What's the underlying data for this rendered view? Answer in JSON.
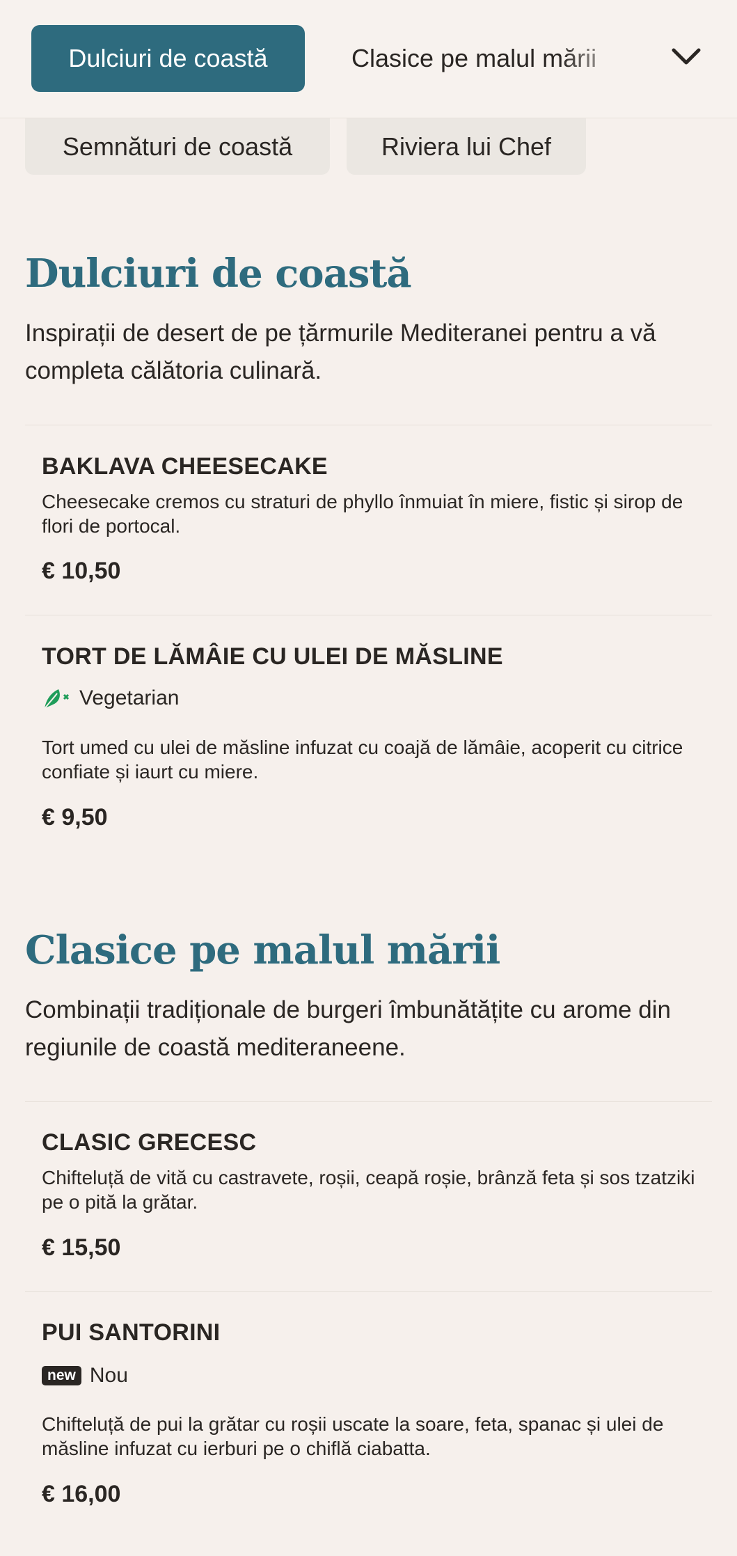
{
  "nav": {
    "active_category": "Dulciuri de coastă",
    "next_category": "Clasice pe malul mării",
    "pills": [
      "Semnături de coastă",
      "Riviera lui Chef"
    ],
    "dropdown_icon": "chevron-down-icon"
  },
  "colors": {
    "accent": "#2e6b7e",
    "background": "#f6f0ec",
    "text": "#2a2623",
    "vegetarian_green": "#1f9d5a"
  },
  "sections": [
    {
      "title": "Dulciuri de coastă",
      "description": "Inspirații de desert de pe țărmurile Mediteranei pentru a vă completa călătoria culinară.",
      "items": [
        {
          "name": "BAKLAVA CHEESECAKE",
          "description": "Cheesecake cremos cu straturi de phyllo înmuiat în miere, fistic și sirop de flori de portocal.",
          "price": "€ 10,50"
        },
        {
          "name": "TORT DE LĂMÂIE CU ULEI DE MĂSLINE",
          "tag_label": "Vegetarian",
          "tag_icon": "vegetarian-leaf-icon",
          "description": "Tort umed cu ulei de măsline infuzat cu coajă de lămâie, acoperit cu citrice confiate și iaurt cu miere.",
          "price": "€ 9,50"
        }
      ]
    },
    {
      "title": "Clasice pe malul mării",
      "description": "Combinații tradiționale de burgeri îmbunătățite cu arome din regiunile de coastă mediteraneene.",
      "items": [
        {
          "name": "CLASIC GRECESC",
          "description": "Chifteluță de vită cu castravete, roșii, ceapă roșie, brânză feta și sos tzatziki pe o pită la grătar.",
          "price": "€ 15,50"
        },
        {
          "name": "PUI SANTORINI",
          "badge": "new",
          "tag_label": "Nou",
          "description": "Chifteluță de pui la grătar cu roșii uscate la soare, feta, spanac și ulei de măsline infuzat cu ierburi pe o chiflă ciabatta.",
          "price": "€ 16,00"
        }
      ]
    }
  ]
}
